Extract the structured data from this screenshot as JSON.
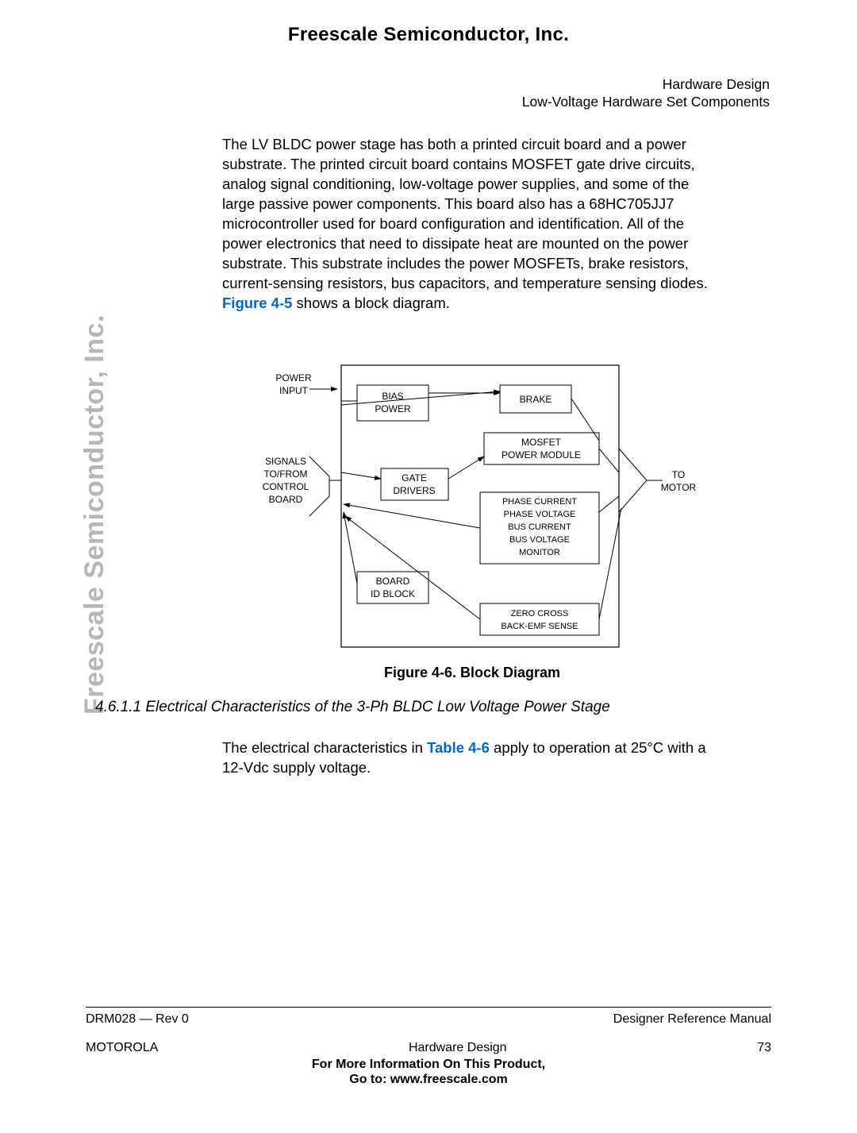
{
  "page_title": "Freescale Semiconductor, Inc.",
  "header": {
    "line1": "Hardware Design",
    "line2": "Low-Voltage Hardware Set Components"
  },
  "sidebar": "Freescale Semiconductor, Inc.",
  "para1_part1": "The LV BLDC power stage has both a printed circuit board and a power substrate. The printed circuit board contains MOSFET gate drive circuits, analog signal conditioning, low-voltage power supplies, and some of the large passive power components. This board also has a 68HC705JJ7 microcontroller used for board configuration and identification. All of the power electronics that need to dissipate heat are mounted on the power substrate. This substrate includes the power MOSFETs, brake resistors, current-sensing resistors, bus capacitors, and temperature sensing diodes. ",
  "para1_link": "Figure 4-5",
  "para1_part2": " shows a block diagram.",
  "figure": {
    "caption": "Figure 4-6. Block Diagram",
    "labels": {
      "power_input_l1": "POWER",
      "power_input_l2": "INPUT",
      "signals_l1": "SIGNALS",
      "signals_l2": "TO/FROM",
      "signals_l3": "CONTROL",
      "signals_l4": "BOARD",
      "to_l1": "TO",
      "to_l2": "MOTOR",
      "bias_l1": "BIAS",
      "bias_l2": "POWER",
      "brake": "BRAKE",
      "gate_l1": "GATE",
      "gate_l2": "DRIVERS",
      "mosfet_l1": "MOSFET",
      "mosfet_l2": "POWER MODULE",
      "monitor_l1": "PHASE CURRENT",
      "monitor_l2": "PHASE VOLTAGE",
      "monitor_l3": "BUS CURRENT",
      "monitor_l4": "BUS VOLTAGE",
      "monitor_l5": "MONITOR",
      "board_l1": "BOARD",
      "board_l2": "ID BLOCK",
      "zero_l1": "ZERO CROSS",
      "zero_l2": "BACK-EMF SENSE"
    }
  },
  "subsection": "4.6.1.1  Electrical Characteristics of the 3-Ph BLDC Low Voltage Power Stage",
  "para2_part1": "The electrical characteristics in ",
  "para2_link": "Table 4-6",
  "para2_part2": " apply to operation at 25°C with a 12-Vdc supply voltage.",
  "footer": {
    "doc_rev": "DRM028 — Rev 0",
    "manual": "Designer Reference Manual",
    "brand": "MOTOROLA",
    "section": "Hardware Design",
    "page": "73",
    "more_info_l1": "For More Information On This Product,",
    "more_info_l2": "Go to: www.freescale.com"
  }
}
